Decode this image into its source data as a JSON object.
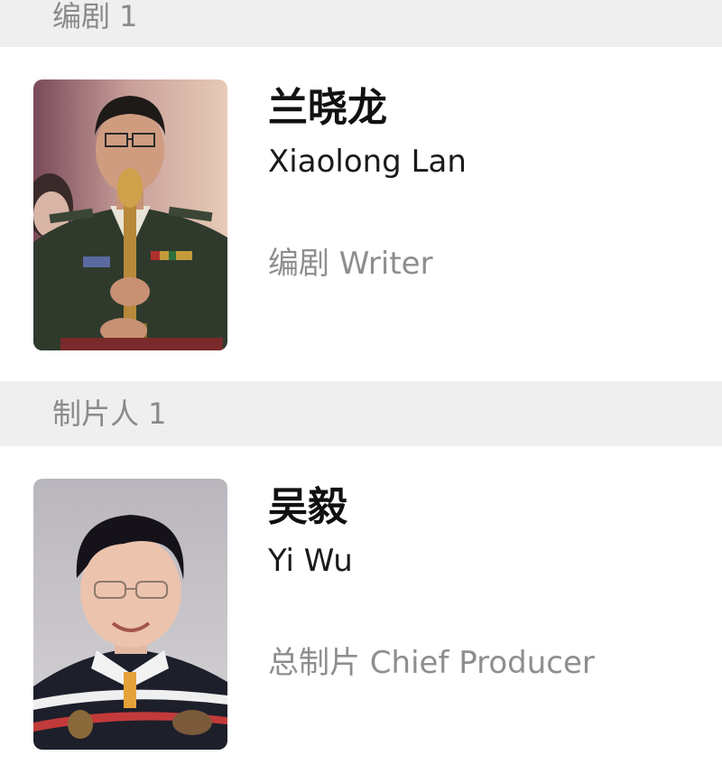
{
  "sections": [
    {
      "header": "编剧 1",
      "person": {
        "name_zh": "兰晓龙",
        "name_en": "Xiaolong Lan",
        "role": "编剧 Writer"
      }
    },
    {
      "header": "制片人 1",
      "person": {
        "name_zh": "吴毅",
        "name_en": "Yi Wu",
        "role": "总制片 Chief Producer"
      }
    }
  ],
  "colors": {
    "header_bg": "#efeff0",
    "header_text": "#8a8a8a",
    "name_text": "#111111",
    "role_text": "#8e8e8e"
  }
}
